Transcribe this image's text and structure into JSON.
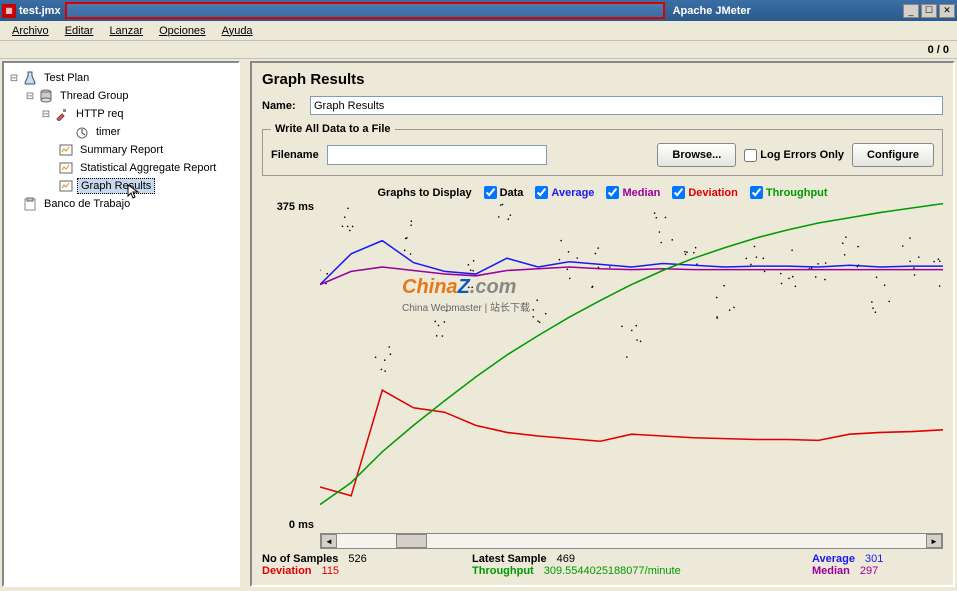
{
  "window": {
    "file": "test.jmx",
    "app": "Apache JMeter"
  },
  "menu": {
    "archivo": "Archivo",
    "editar": "Editar",
    "lanzar": "Lanzar",
    "opciones": "Opciones",
    "ayuda": "Ayuda"
  },
  "status": {
    "counter": "0 / 0"
  },
  "tree": {
    "testplan": "Test Plan",
    "threadgroup": "Thread Group",
    "httpreq": "HTTP req",
    "timer": "timer",
    "summary": "Summary Report",
    "statagg": "Statistical Aggregate Report",
    "graphresults": "Graph Results",
    "banco": "Banco de Trabajo"
  },
  "panel": {
    "title": "Graph Results",
    "name_label": "Name:",
    "name_value": "Graph Results",
    "fieldset_legend": "Write All Data to a File",
    "filename_label": "Filename",
    "filename_value": "",
    "browse": "Browse...",
    "logerrors": "Log Errors Only",
    "configure": "Configure",
    "graphs_label": "Graphs to Display",
    "cb_data": "Data",
    "cb_avg": "Average",
    "cb_med": "Median",
    "cb_dev": "Deviation",
    "cb_thr": "Throughput"
  },
  "axis": {
    "ymax": "375 ms",
    "ymin": "0 ms"
  },
  "stats": {
    "nsamples_label": "No of Samples",
    "nsamples": "526",
    "latest_label": "Latest Sample",
    "latest": "469",
    "average_label": "Average",
    "average": "301",
    "deviation_label": "Deviation",
    "deviation": "115",
    "throughput_label": "Throughput",
    "throughput": "309.5544025188077/minute",
    "median_label": "Median",
    "median": "297"
  },
  "watermark": {
    "line1": "ChinaZ.com",
    "line2": "China Webmaster | 站长下载"
  },
  "chart_data": {
    "type": "line",
    "xlabel": "",
    "ylabel": "ms",
    "ylim": [
      0,
      375
    ],
    "x": [
      0,
      5,
      10,
      15,
      20,
      25,
      30,
      35,
      40,
      45,
      50,
      55,
      60,
      65,
      70,
      75,
      80,
      85,
      90,
      95,
      100
    ],
    "series": [
      {
        "name": "Data",
        "color": "#000000",
        "type": "scatter",
        "values": [
          280,
          360,
          200,
          330,
          230,
          290,
          360,
          260,
          310,
          300,
          220,
          340,
          300,
          260,
          310,
          300,
          300,
          320,
          270,
          310,
          300
        ]
      },
      {
        "name": "Average",
        "color": "#1a1af2",
        "values": [
          280,
          315,
          330,
          305,
          295,
          292,
          310,
          300,
          306,
          303,
          300,
          304,
          302,
          300,
          301,
          301,
          300,
          302,
          300,
          301,
          301
        ]
      },
      {
        "name": "Median",
        "color": "#9a009a",
        "values": [
          280,
          295,
          300,
          296,
          292,
          290,
          296,
          298,
          300,
          298,
          297,
          298,
          297,
          297,
          297,
          297,
          297,
          297,
          297,
          297,
          297
        ]
      },
      {
        "name": "Deviation",
        "color": "#e00000",
        "values": [
          50,
          40,
          160,
          140,
          135,
          120,
          112,
          108,
          105,
          102,
          110,
          108,
          106,
          105,
          104,
          104,
          103,
          110,
          112,
          113,
          115
        ]
      },
      {
        "name": "Throughput",
        "color": "#009a00",
        "values": [
          30,
          55,
          90,
          120,
          148,
          175,
          200,
          222,
          243,
          262,
          280,
          296,
          310,
          322,
          333,
          342,
          350,
          356,
          362,
          367,
          372
        ]
      }
    ]
  }
}
